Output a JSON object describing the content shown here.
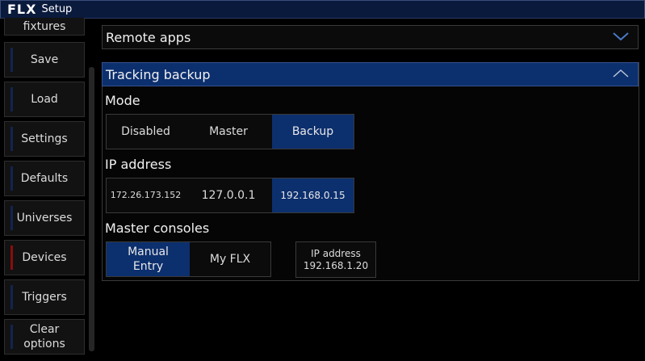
{
  "titlebar": {
    "logo": "FLX",
    "title": "Setup"
  },
  "sidebar": {
    "items": [
      {
        "label": "fixtures"
      },
      {
        "label": "Save"
      },
      {
        "label": "Load"
      },
      {
        "label": "Settings"
      },
      {
        "label": "Defaults"
      },
      {
        "label": "Universes"
      },
      {
        "label": "Devices"
      },
      {
        "label": "Triggers"
      },
      {
        "label": "Clear options"
      }
    ]
  },
  "sections": {
    "remote_apps": {
      "label": "Remote apps",
      "state": "collapsed"
    },
    "tracking_backup": {
      "label": "Tracking backup",
      "state": "expanded",
      "mode": {
        "label": "Mode",
        "options": [
          "Disabled",
          "Master",
          "Backup"
        ],
        "selected": "Backup"
      },
      "ip_address": {
        "label": "IP address",
        "options": [
          "172.26.173.152",
          "127.0.0.1",
          "192.168.0.15"
        ],
        "selected": "192.168.0.15"
      },
      "master_consoles": {
        "label": "Master consoles",
        "options": [
          "Manual Entry",
          "My FLX"
        ],
        "selected": "Manual Entry",
        "ip_box": {
          "label": "IP address",
          "value": "192.168.1.20"
        }
      }
    }
  },
  "colors": {
    "accent": "#0c2f6e",
    "titlebar": "#0a1a3c",
    "active_marker": "#8b0d0d",
    "marker": "#12244f",
    "background": "#000000"
  },
  "icons": {
    "expand": "chevron-down-icon",
    "collapse": "chevron-up-icon"
  }
}
